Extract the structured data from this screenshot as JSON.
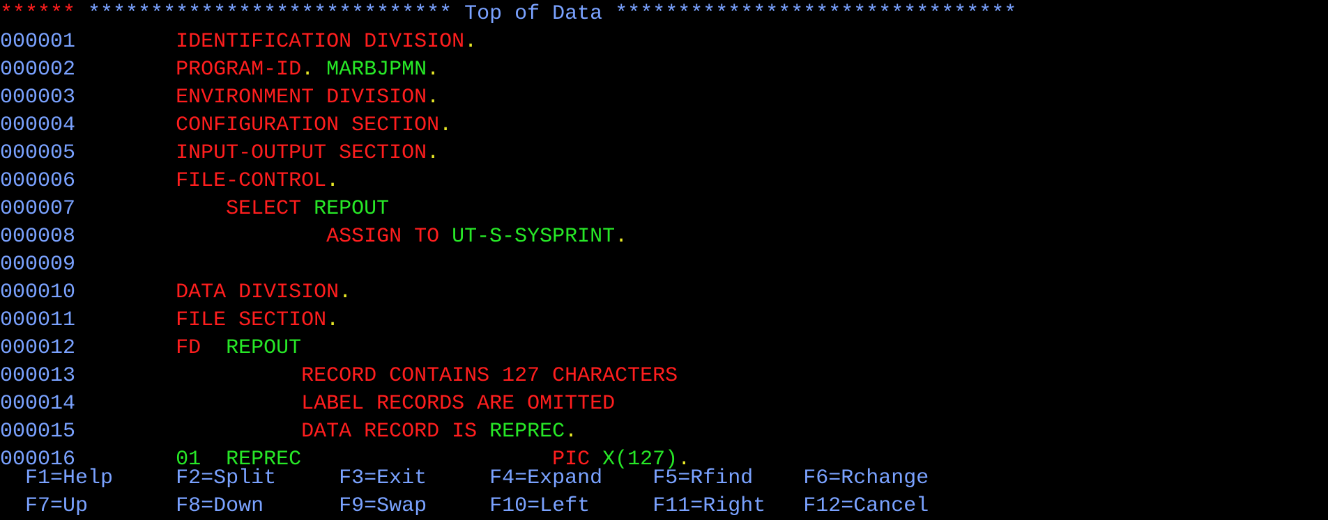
{
  "banner": {
    "stars_left": "******",
    "stars_mid_l": "*****************************",
    "label": " Top of Data ",
    "stars_mid_r": "********************************"
  },
  "lines": [
    {
      "seq": "000001",
      "tokens": [
        {
          "c": "kw",
          "t": "IDENTIFICATION DIVISION"
        },
        {
          "c": "punct",
          "t": "."
        }
      ],
      "indent": 8
    },
    {
      "seq": "000002",
      "tokens": [
        {
          "c": "kw",
          "t": "PROGRAM-ID"
        },
        {
          "c": "punct",
          "t": ". "
        },
        {
          "c": "id",
          "t": "MARBJPMN"
        },
        {
          "c": "punct",
          "t": "."
        }
      ],
      "indent": 8
    },
    {
      "seq": "000003",
      "tokens": [
        {
          "c": "kw",
          "t": "ENVIRONMENT DIVISION"
        },
        {
          "c": "punct",
          "t": "."
        }
      ],
      "indent": 8
    },
    {
      "seq": "000004",
      "tokens": [
        {
          "c": "kw",
          "t": "CONFIGURATION SECTION"
        },
        {
          "c": "punct",
          "t": "."
        }
      ],
      "indent": 8
    },
    {
      "seq": "000005",
      "tokens": [
        {
          "c": "kw",
          "t": "INPUT-OUTPUT SECTION"
        },
        {
          "c": "punct",
          "t": "."
        }
      ],
      "indent": 8
    },
    {
      "seq": "000006",
      "tokens": [
        {
          "c": "kw",
          "t": "FILE-CONTROL"
        },
        {
          "c": "punct",
          "t": "."
        }
      ],
      "indent": 8
    },
    {
      "seq": "000007",
      "tokens": [
        {
          "c": "kw",
          "t": "SELECT "
        },
        {
          "c": "id",
          "t": "REPOUT"
        }
      ],
      "indent": 12
    },
    {
      "seq": "000008",
      "tokens": [
        {
          "c": "kw",
          "t": "ASSIGN TO "
        },
        {
          "c": "id",
          "t": "UT-S-SYSPRINT"
        },
        {
          "c": "punct",
          "t": "."
        }
      ],
      "indent": 20
    },
    {
      "seq": "000009",
      "tokens": [],
      "indent": 8
    },
    {
      "seq": "000010",
      "tokens": [
        {
          "c": "kw",
          "t": "DATA DIVISION"
        },
        {
          "c": "punct",
          "t": "."
        }
      ],
      "indent": 8
    },
    {
      "seq": "000011",
      "tokens": [
        {
          "c": "kw",
          "t": "FILE SECTION"
        },
        {
          "c": "punct",
          "t": "."
        }
      ],
      "indent": 8
    },
    {
      "seq": "000012",
      "tokens": [
        {
          "c": "kw",
          "t": "FD  "
        },
        {
          "c": "id",
          "t": "REPOUT"
        }
      ],
      "indent": 8
    },
    {
      "seq": "000013",
      "tokens": [
        {
          "c": "kw",
          "t": "RECORD CONTAINS 127 CHARACTERS"
        }
      ],
      "indent": 18
    },
    {
      "seq": "000014",
      "tokens": [
        {
          "c": "kw",
          "t": "LABEL RECORDS ARE OMITTED"
        }
      ],
      "indent": 18
    },
    {
      "seq": "000015",
      "tokens": [
        {
          "c": "kw",
          "t": "DATA RECORD IS "
        },
        {
          "c": "id",
          "t": "REPREC"
        },
        {
          "c": "punct",
          "t": "."
        }
      ],
      "indent": 18
    },
    {
      "seq": "000016",
      "tokens": [
        {
          "c": "id",
          "t": "01  REPREC                    "
        },
        {
          "c": "kw",
          "t": "PIC "
        },
        {
          "c": "id",
          "t": "X(127)"
        },
        {
          "c": "punct",
          "t": "."
        }
      ],
      "indent": 8
    }
  ],
  "footer": {
    "row1": [
      {
        "key": "F1",
        "label": "Help"
      },
      {
        "key": "F2",
        "label": "Split"
      },
      {
        "key": "F3",
        "label": "Exit"
      },
      {
        "key": "F4",
        "label": "Expand"
      },
      {
        "key": "F5",
        "label": "Rfind"
      },
      {
        "key": "F6",
        "label": "Rchange"
      }
    ],
    "row2": [
      {
        "key": "F7",
        "label": "Up"
      },
      {
        "key": "F8",
        "label": "Down"
      },
      {
        "key": "F9",
        "label": "Swap"
      },
      {
        "key": "F10",
        "label": "Left"
      },
      {
        "key": "F11",
        "label": "Right"
      },
      {
        "key": "F12",
        "label": "Cancel"
      }
    ]
  }
}
